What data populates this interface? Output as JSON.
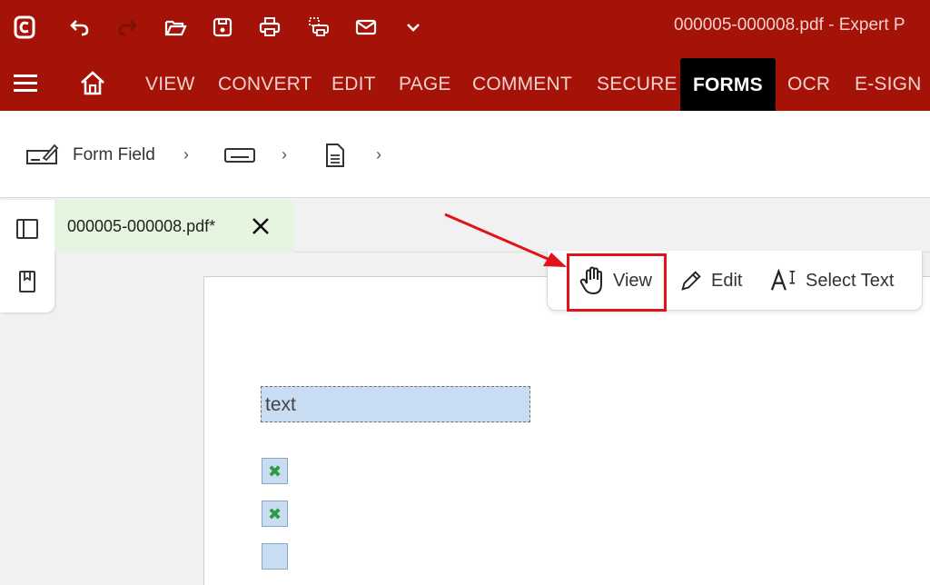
{
  "titlebar": {
    "document_title": "000005-000008.pdf  -  Expert P",
    "icons": [
      "app-logo-icon",
      "undo-icon",
      "redo-icon",
      "open-folder-icon",
      "save-icon",
      "print-icon",
      "batch-print-icon",
      "mail-icon",
      "chevron-down-icon"
    ]
  },
  "ribbon": {
    "tabs": [
      {
        "label": "VIEW"
      },
      {
        "label": "CONVERT"
      },
      {
        "label": "EDIT"
      },
      {
        "label": "PAGE"
      },
      {
        "label": "COMMENT"
      },
      {
        "label": "SECURE"
      },
      {
        "label": "FORMS",
        "active": true
      },
      {
        "label": "OCR"
      },
      {
        "label": "E-SIGN"
      }
    ]
  },
  "breadcrumb": {
    "items": [
      {
        "label": "Form Field",
        "icon": "form-field-icon"
      },
      {
        "label": "",
        "icon": "text-field-icon"
      },
      {
        "label": "",
        "icon": "document-icon"
      }
    ]
  },
  "document_tab": {
    "label": "000005-000008.pdf*",
    "close_icon": "close-icon"
  },
  "mode_bar": {
    "view_label": "View",
    "edit_label": "Edit",
    "select_text_label": "Select Text"
  },
  "page": {
    "text_field_value": "text",
    "checkboxes": [
      {
        "checked": true
      },
      {
        "checked": true
      },
      {
        "checked": false
      }
    ]
  },
  "colors": {
    "brand_red": "#a51208",
    "active_tab": "#000000",
    "doc_tab_bg": "#e6f5df",
    "field_bg": "#c8dcf2",
    "annotation_red": "#e0131b",
    "check_green": "#2e9a45"
  }
}
